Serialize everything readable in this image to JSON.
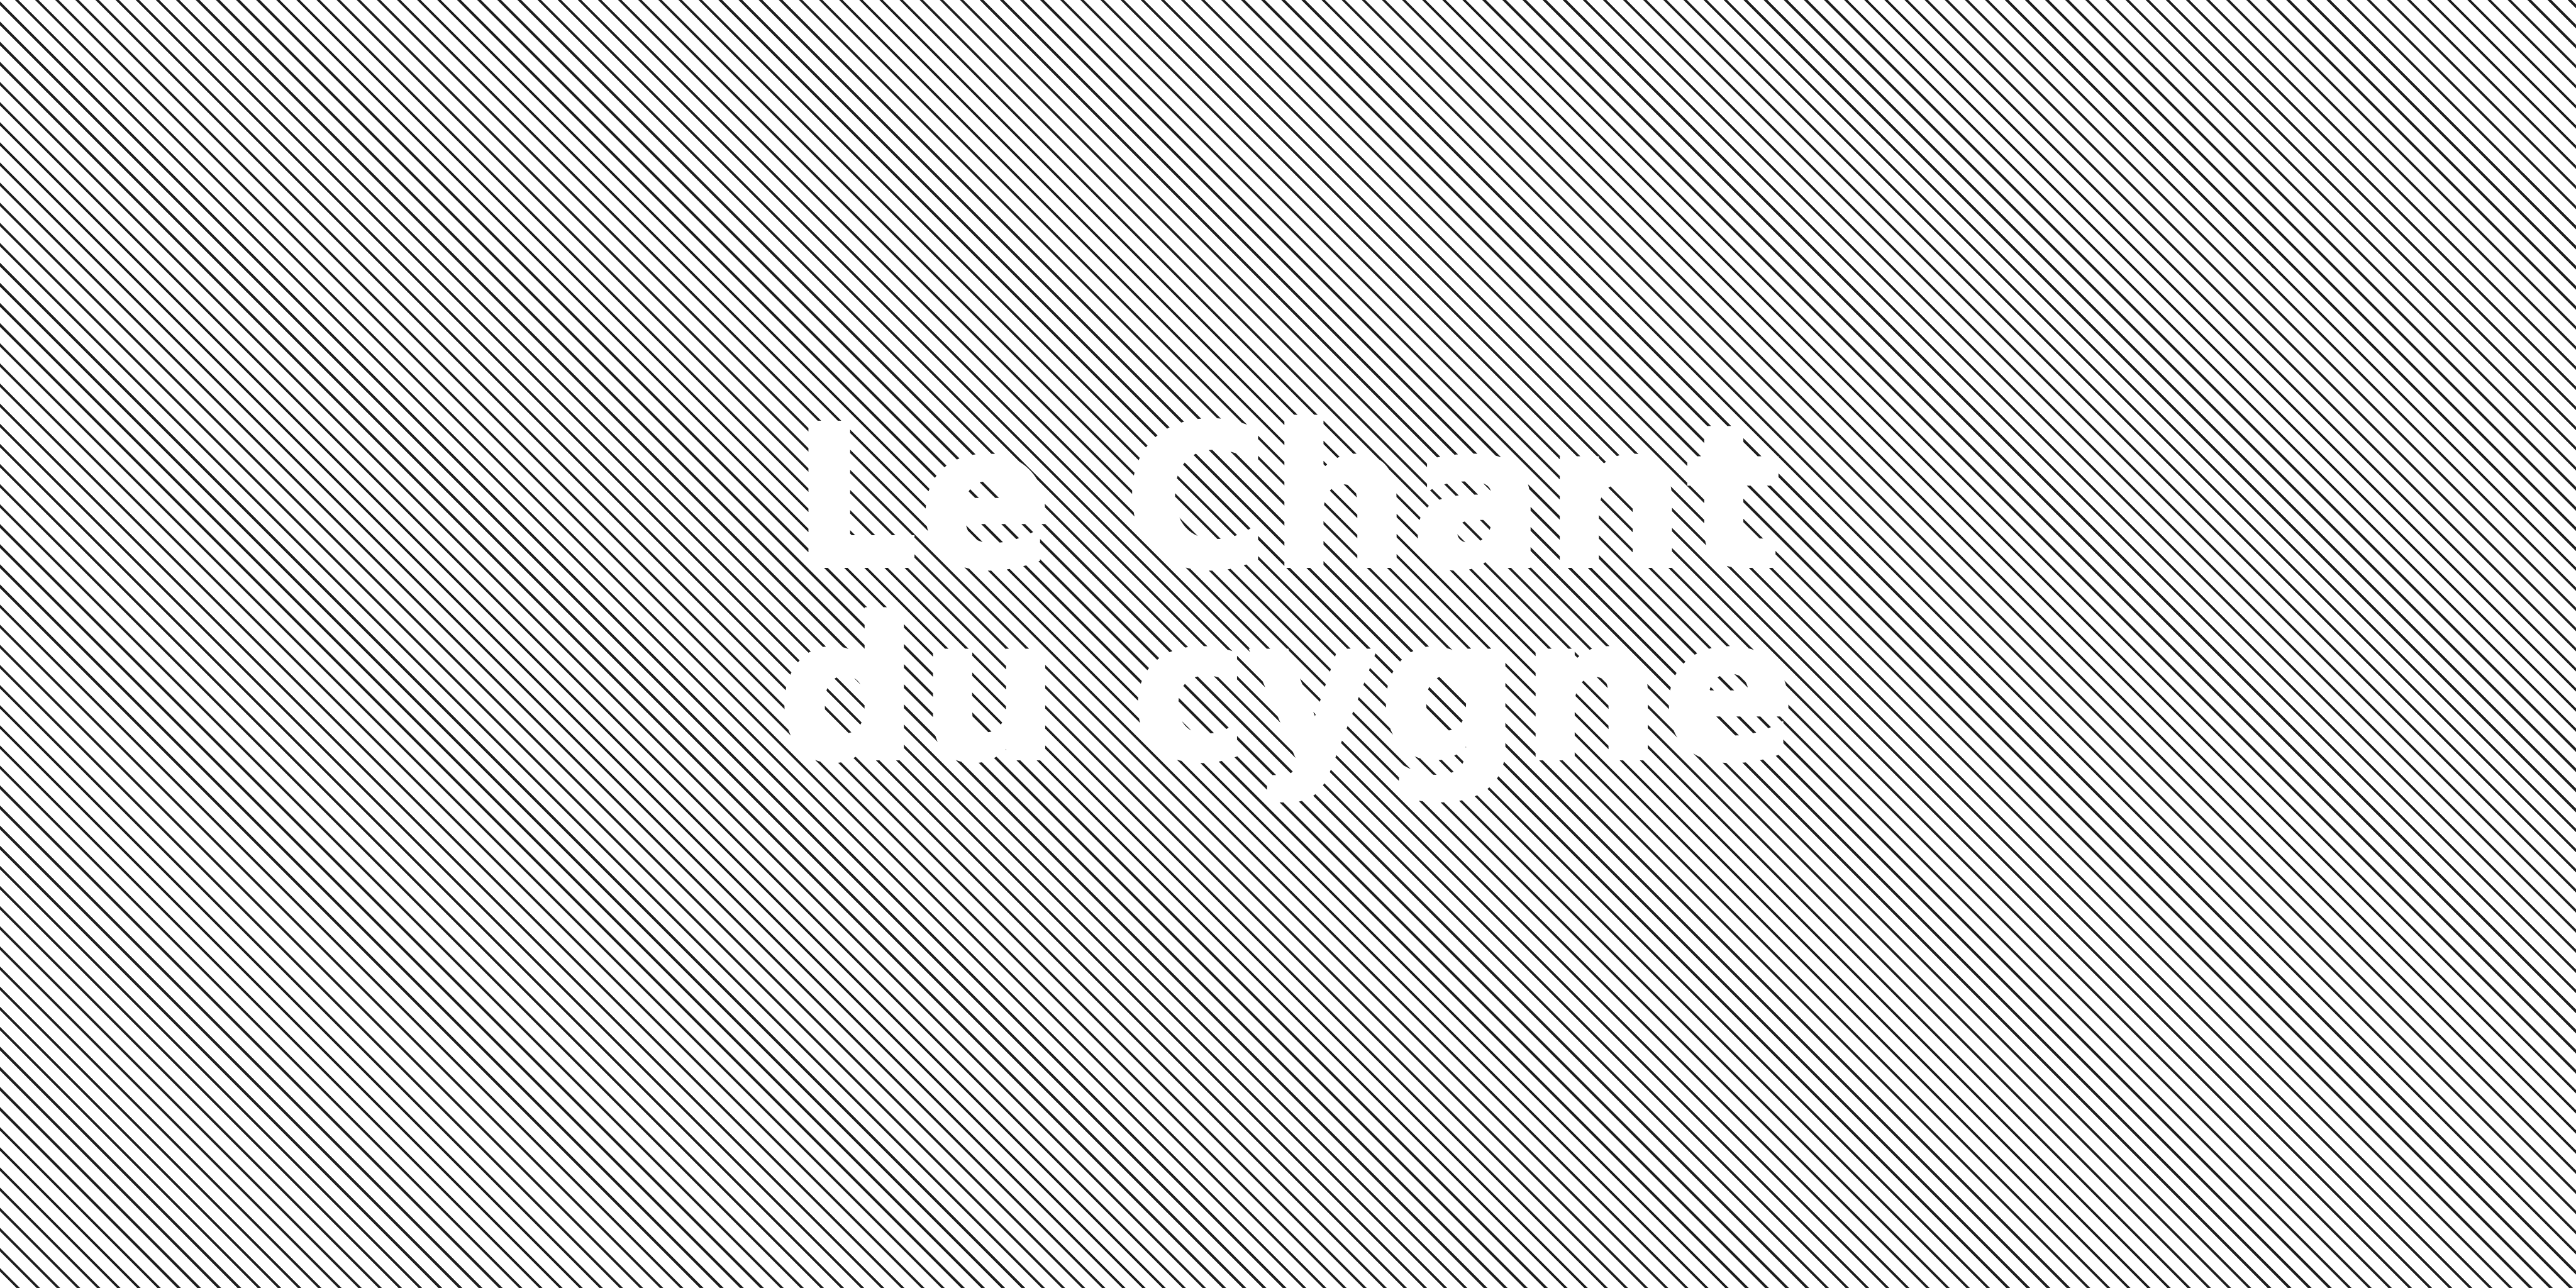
{
  "title": {
    "line1": "Le Chant",
    "line2": "du cygne"
  },
  "colors": {
    "stripe": "#1e1e1e",
    "background": "#ffffff",
    "text": "#ffffff"
  },
  "pattern": "diagonal-lines"
}
